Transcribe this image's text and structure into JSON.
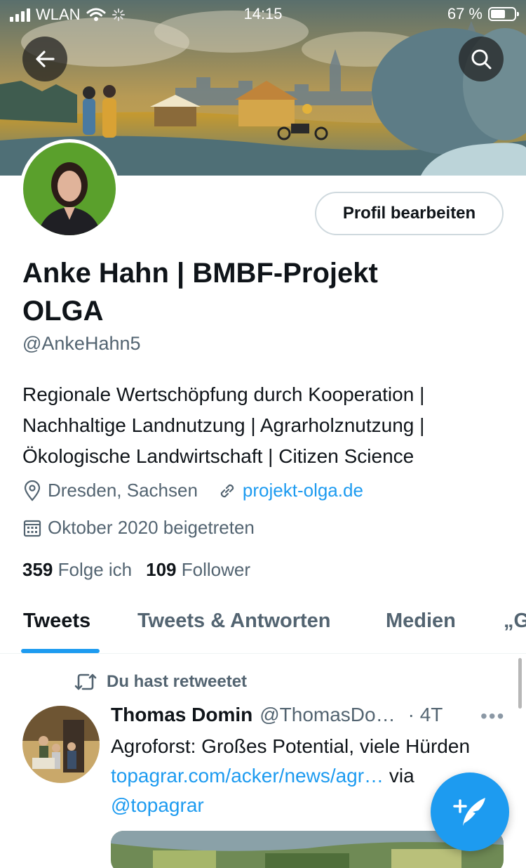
{
  "status_bar": {
    "carrier": "WLAN",
    "time": "14:15",
    "battery": "67 %"
  },
  "profile": {
    "edit_button": "Profil bearbeiten",
    "name": "Anke Hahn | BMBF-Projekt OLGA",
    "handle": "@AnkeHahn5",
    "bio": [
      "Regionale Wertschöpfung durch Kooperation |",
      "Nachhaltige Landnutzung | Agrarholznutzung |",
      "Ökologische Landwirtschaft | Citizen Science"
    ],
    "location": "Dresden, Sachsen",
    "website": "projekt-olga.de",
    "joined": "Oktober 2020 beigetreten",
    "following_count": "359",
    "following_label": "Folge ich",
    "followers_count": "109",
    "followers_label": "Follower"
  },
  "tabs": [
    "Tweets",
    "Tweets & Antworten",
    "Medien",
    "„G"
  ],
  "tweet": {
    "retweet_label": "Du hast retweetet",
    "author": "Thomas Domin",
    "handle": "@ThomasDo…",
    "time": "· 4T",
    "text_plain_1": "Agroforst: Großes Potential, viele Hürden",
    "link_1": "topagrar.com/acker/news/agr…",
    "text_plain_2": "via",
    "link_2": "@topagrar"
  },
  "colors": {
    "accent": "#1d9bf0",
    "secondary_text": "#536471",
    "primary_text": "#0f1419",
    "avatar_bg": "#5aa02c"
  },
  "icons": [
    "back-arrow-icon",
    "search-icon",
    "location-pin-icon",
    "link-icon",
    "calendar-icon",
    "retweet-icon",
    "more-icon",
    "compose-icon"
  ]
}
